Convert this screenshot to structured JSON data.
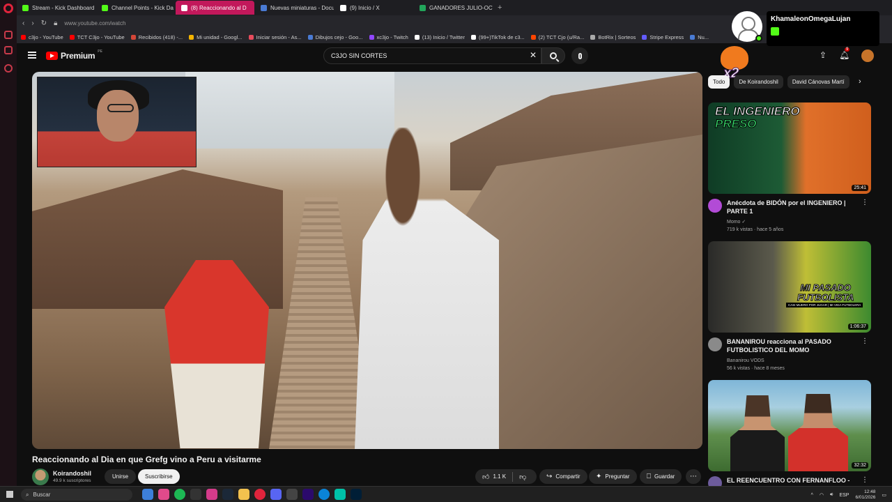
{
  "browser": {
    "tabs": [
      {
        "label": "Stream - Kick Dashboard",
        "color": "#53fc18",
        "active": false
      },
      {
        "label": "Channel Points - Kick Da",
        "color": "#53fc18",
        "active": false
      },
      {
        "label": "(8) Reaccionando al D",
        "color": "#ffffff",
        "active": true
      },
      {
        "label": "Nuevas miniaturas - Docu",
        "color": "#4a7bd4",
        "active": false
      },
      {
        "label": "(9) Inicio / X",
        "color": "#ffffff",
        "active": false
      },
      {
        "label": "GANADORES JULIO-OCT",
        "color": "#22a55a",
        "active": false
      }
    ],
    "new_tab": "+",
    "url": "www.youtube.com/watch",
    "bookmarks": [
      {
        "label": "c3jo - YouTube",
        "color": "#ff0000"
      },
      {
        "label": "TCT C3jo - YouTube",
        "color": "#ff0000"
      },
      {
        "label": "Recibidos (418) -...",
        "color": "#d44638"
      },
      {
        "label": "Mi unidad - Googl...",
        "color": "#f4b400"
      },
      {
        "label": "Iniciar sesión - As...",
        "color": "#e84b5c"
      },
      {
        "label": "Dibujos cejo - Goo...",
        "color": "#4a7bd4"
      },
      {
        "label": "xc3jo - Twitch",
        "color": "#9146ff"
      },
      {
        "label": "(13) Inicio / Twitter",
        "color": "#ffffff"
      },
      {
        "label": "(99+)TikTok de c3...",
        "color": "#ffffff"
      },
      {
        "label": "(2) TCT Cjo (u/Ra...",
        "color": "#ff4500"
      },
      {
        "label": "BotRix | Sorteos",
        "color": "#aaaaaa"
      },
      {
        "label": "Stripe Express",
        "color": "#635bff"
      },
      {
        "label": "Nu...",
        "color": "#4a7bd4"
      }
    ]
  },
  "youtube": {
    "brand": "Premium",
    "brand_sup": "PE",
    "search_value": "C3JO SIN CORTES",
    "notification_count": "9"
  },
  "overlay": {
    "username": "KhamaleonOmegaLujan",
    "multiplier": "x2"
  },
  "chips": [
    "Todo",
    "De Koirandoshil",
    "David Cánovas Martí"
  ],
  "video": {
    "title": "Reaccionando al Dia en que Grefg vino a Peru a visitarme",
    "channel": "Koirandoshil",
    "subscribers": "49.9 k suscriptores",
    "join_label": "Unirse",
    "subscribe_label": "Suscribirse",
    "likes": "1.1 K",
    "share_label": "Compartir",
    "ask_label": "Preguntar",
    "save_label": "Guardar"
  },
  "recommendations": [
    {
      "title": "Anécdota de BIDÓN por el INGENIERO | PARTE 1",
      "channel": "Momo",
      "meta": "719 k vistas · hace 5 años",
      "duration": "25:41",
      "thumb_text_1": "EL INGENIERO",
      "thumb_text_2": "PRESO",
      "avatar_color": "#b24bd6"
    },
    {
      "title": "BANANIROU reacciona al PASADO FUTBOLISTICO DEL MOMO",
      "channel": "Bananirou VODS",
      "meta": "56 k vistas · hace 8 meses",
      "duration": "1:06:37",
      "thumb_text_1": "MI PASADO",
      "thumb_text_2": "FUTBOLISTA",
      "thumb_sub": "CASI MUERO POR JUGAR | MI VIDA FUTBOLERA",
      "avatar_color": "#8a8a8a"
    },
    {
      "title": "EL REENCUENTRO CON FERNANFLOO -",
      "channel": "",
      "meta": "",
      "duration": "32:32",
      "avatar_color": "#6d5c9c"
    }
  ],
  "taskbar": {
    "search_placeholder": "Buscar",
    "lang": "ESP",
    "time": "12:48",
    "date": "6/01/2026"
  }
}
